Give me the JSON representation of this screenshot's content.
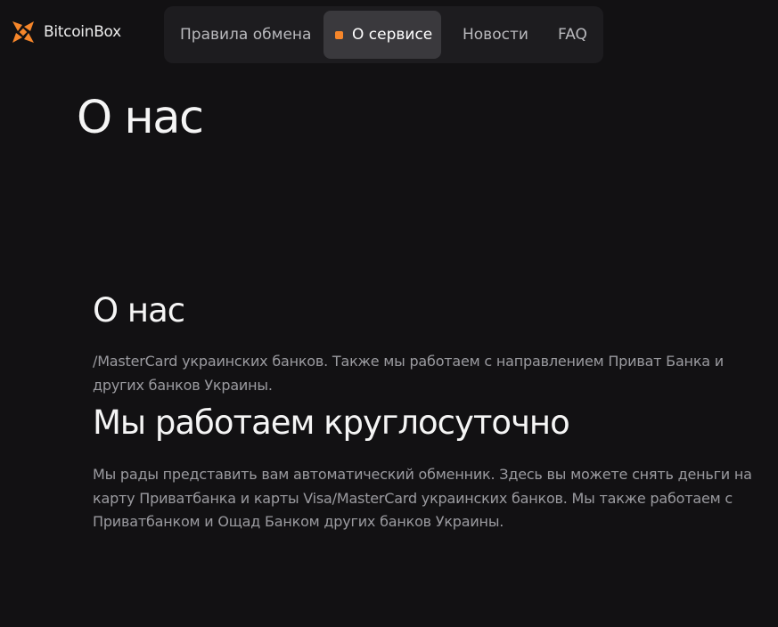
{
  "header": {
    "logo_text": "BitcoinBox",
    "logo_color": "#f6862a",
    "nav": {
      "items": [
        {
          "label": "Правила обмена",
          "active": false
        },
        {
          "label": "О сервисе",
          "active": true
        },
        {
          "label": "Новости",
          "active": false
        },
        {
          "label": "FAQ",
          "active": false
        }
      ]
    }
  },
  "main": {
    "page_title": "О нас",
    "sections": [
      {
        "heading": "О нас",
        "text": "/MasterCard украинских банков. Также мы работаем с направлением Приват Банка и других банков Украины."
      },
      {
        "heading": "Мы работаем круглосуточно",
        "text": "Мы рады представить вам автоматический обменник. Здесь вы можете снять деньги на карту Приватбанка и карты Visa/MasterCard украинских банков. Мы также работаем с Приватбанком и Ощад Банком других банков Украины."
      }
    ]
  },
  "colors": {
    "background": "#121113",
    "nav_background": "#1d1c1f",
    "nav_active_background": "#3a393d",
    "accent": "#f6862a"
  }
}
